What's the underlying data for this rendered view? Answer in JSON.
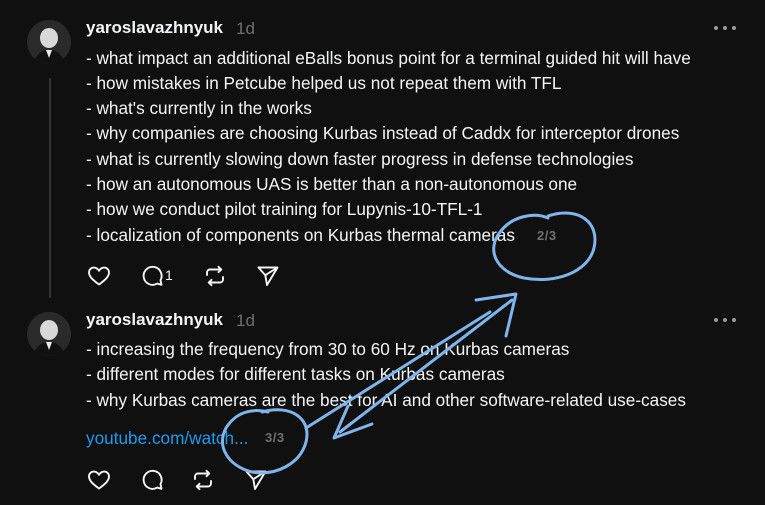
{
  "posts": [
    {
      "username": "yaroslavazhnyuk",
      "time": "1d",
      "lines": [
        "- what impact an additional eBalls bonus point for a terminal guided hit will have",
        "- how mistakes in Petcube helped us not repeat them with TFL",
        "- what's currently in the works",
        "- why companies are choosing Kurbas instead of Caddx for interceptor drones",
        "- what is currently slowing down faster progress in defense technologies",
        "- how an autonomous UAS is better than a non-autonomous one",
        "- how we conduct pilot training for Lupynis-10-TFL-1",
        "- localization of components on Kurbas thermal cameras"
      ],
      "counter": "2/3",
      "reply_count": "1"
    },
    {
      "username": "yaroslavazhnyuk",
      "time": "1d",
      "lines": [
        "- increasing the frequency from 30 to 60 Hz on Kurbas cameras",
        "- different modes for different tasks on Kurbas cameras",
        "- why Kurbas cameras are the best for AI and other software-related use-cases"
      ],
      "link_text": "youtube.com/watch...",
      "counter": "3/3"
    }
  ],
  "icons": {
    "like": "heart-icon",
    "reply": "comment-icon",
    "repost": "repost-icon",
    "share": "send-icon",
    "more": "more-dots-icon"
  },
  "colors": {
    "background": "#101010",
    "text": "#f3f5f7",
    "muted": "#6f6f6f",
    "link": "#1d9bf0",
    "annotation": "#7fb5ec"
  }
}
